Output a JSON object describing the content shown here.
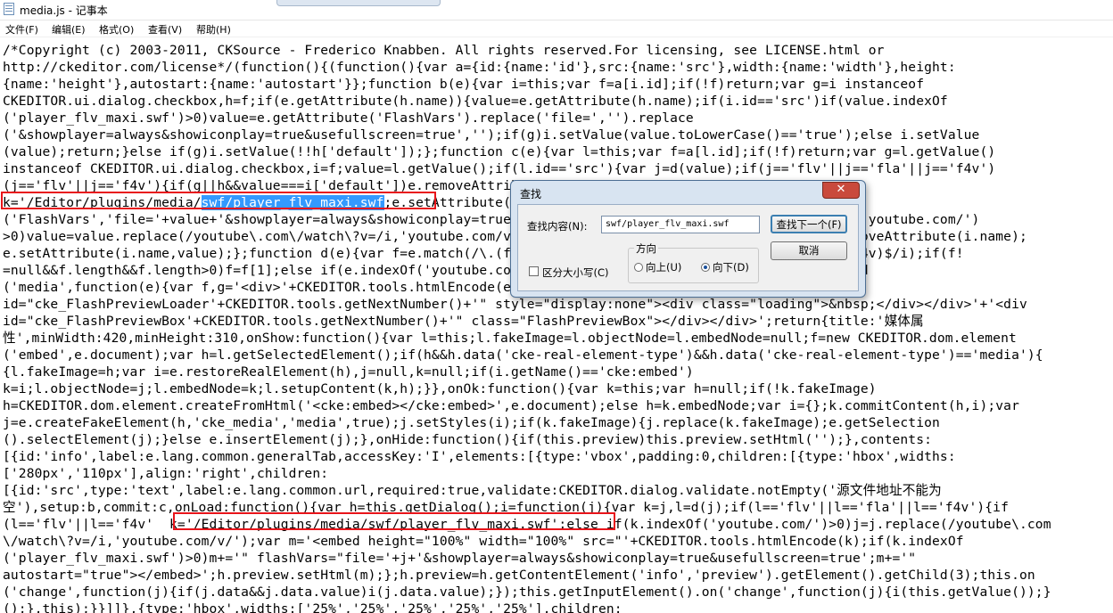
{
  "window": {
    "title": "media.js - 记事本"
  },
  "menu": [
    "文件(F)",
    "编辑(E)",
    "格式(O)",
    "查看(V)",
    "帮助(H)"
  ],
  "editor": {
    "lines": [
      "/*Copyright (c) 2003-2011, CKSource - Frederico Knabben. All rights reserved.For licensing, see LICENSE.html or",
      "http://ckeditor.com/license*/(function(){(function(){var a={id:{name:'id'},src:{name:'src'},width:{name:'width'},height:",
      "{name:'height'},autostart:{name:'autostart'}};function b(e){var i=this;var f=a[i.id];if(!f)return;var g=i instanceof",
      "CKEDITOR.ui.dialog.checkbox,h=f;if(e.getAttribute(h.name)){value=e.getAttribute(h.name);if(i.id=='src')if(value.indexOf",
      "('player_flv_maxi.swf')>0)value=e.getAttribute('FlashVars').replace('file=','').replace",
      "('&showplayer=always&showiconplay=true&usefullscreen=true','');if(g)i.setValue(value.toLowerCase()=='true');else i.setValue",
      "(value);return;}else if(g)i.setValue(!!h['default']);};function c(e){var l=this;var f=a[l.id];if(!f)return;var g=l.getValue()",
      "instanceof CKEDITOR.ui.dialog.checkbox,i=f;value=l.getValue();if(l.id=='src'){var j=d(value);if(j=='flv'||j=='fla'||j=='f4v')",
      "(j=='flv'||j=='f4v'){if(g||h&&value===i['default'])e.removeAttribute(i.name);",
      "k='/Editor/plugins/media/",
      "('FlashVars','file='+value+'&showplayer=always&showiconplay=true&usefullscreen=true');else if(value.indexOf('youtube.com/')",
      ">0)value=value.replace(/youtube\\.com\\/watch\\?v=/i,'youtube.com/v/');e.setAttribute(i.name,value);}else e.removeAttribute(i.name);",
      "e.setAttribute(i.name,value);};function d(e){var f=e.match(/\\.(flv|fla|f4v|mp3|mp4|avi|mpeg|qt|swf|wma|wmv|f4v)$/i);if(f!",
      "=null&&f.length&&f.length>0)f=f[1];else if(e.indexOf('youtube.com/')>0)f='swf';return f;};CKEDITOR.dialog.add",
      "('media',function(e){var f,g='<div>'+CKEDITOR.tools.htmlEncode(e.lang.common.preview)+'<br>'+'<div id=\"'+",
      "id=\"cke_FlashPreviewLoader'+CKEDITOR.tools.getNextNumber()+'\" style=\"display:none\"><div class=\"loading\">&nbsp;</div></div>'+'<div",
      "id=\"cke_FlashPreviewBox'+CKEDITOR.tools.getNextNumber()+'\" class=\"FlashPreviewBox\"></div></div>';return{title:'媒体属",
      "性',minWidth:420,minHeight:310,onShow:function(){var l=this;l.fakeImage=l.objectNode=l.embedNode=null;f=new CKEDITOR.dom.element",
      "('embed',e.document);var h=l.getSelectedElement();if(h&&h.data('cke-real-element-type')&&h.data('cke-real-element-type')=='media'){",
      "{l.fakeImage=h;var i=e.restoreRealElement(h),j=null,k=null;if(i.getName()=='cke:embed')",
      "k=i;l.objectNode=j;l.embedNode=k;l.setupContent(k,h);}},onOk:function(){var k=this;var h=null;if(!k.fakeImage)",
      "h=CKEDITOR.dom.element.createFromHtml('<cke:embed></cke:embed>',e.document);else h=k.embedNode;var i={};k.commitContent(h,i);var",
      "j=e.createFakeElement(h,'cke_media','media',true);j.setStyles(i);if(k.fakeImage){j.replace(k.fakeImage);e.getSelection",
      "().selectElement(j);}else e.insertElement(j);},onHide:function(){if(this.preview)this.preview.setHtml('');},contents:",
      "[{id:'info',label:e.lang.common.generalTab,accessKey:'I',elements:[{type:'vbox',padding:0,children:[{type:'hbox',widths:",
      "['280px','110px'],align:'right',children:",
      "[{id:'src',type:'text',label:e.lang.common.url,required:true,validate:CKEDITOR.dialog.validate.notEmpty('源文件地址不能为",
      "空'),setup:b,commit:c,onLoad:function(){var h=this.getDialog();i=function(j){var k=j,l=d(j);if(l=='flv'||l=='fla'||l=='f4v'){if",
      "(l=='flv'||l=='f4v'  k='/Editor/plugins/media/swf/player_flv_maxi.swf';else if(k.indexOf('youtube.com/')>0)j=j.replace(/youtube\\.com",
      "\\/watch\\?v=/i,'youtube.com/v/');var m='<embed height=\"100%\" width=\"100%\" src=\"'+CKEDITOR.tools.htmlEncode(k);if(k.indexOf",
      "('player_flv_maxi.swf')>0)m+='\" flashVars=\"file='+j+'&showplayer=always&showiconplay=true&usefullscreen=true';m+='\"",
      "autostart=\"true\"></embed>';h.preview.setHtml(m);};h.preview=h.getContentElement('info','preview').getElement().getChild(3);this.on",
      "('change',function(j){if(j.data&&j.data.value)i(j.data.value);});this.getInputElement().on('change',function(j){i(this.getValue());}",
      "();},this);}}]]},{type:'hbox',widths:['25%','25%','25%','25%','25%'],children:"
    ],
    "line10_highlight": "swf/player_flv_maxi.swf",
    "line10_rest": ";e.setAttribute('allowFullScreen','true');e.setAttribute"
  },
  "find_dialog": {
    "title": "查找",
    "close": "✕",
    "find_what_label": "查找内容(N):",
    "find_what_value": "swf/player_flv_maxi.swf",
    "find_next_button": "查找下一个(F)",
    "cancel_button": "取消",
    "direction_label": "方向",
    "up_label": "向上(U)",
    "down_label": "向下(D)",
    "match_case_label": "区分大小写(C)",
    "direction_selected": "down",
    "match_case_checked": false
  }
}
